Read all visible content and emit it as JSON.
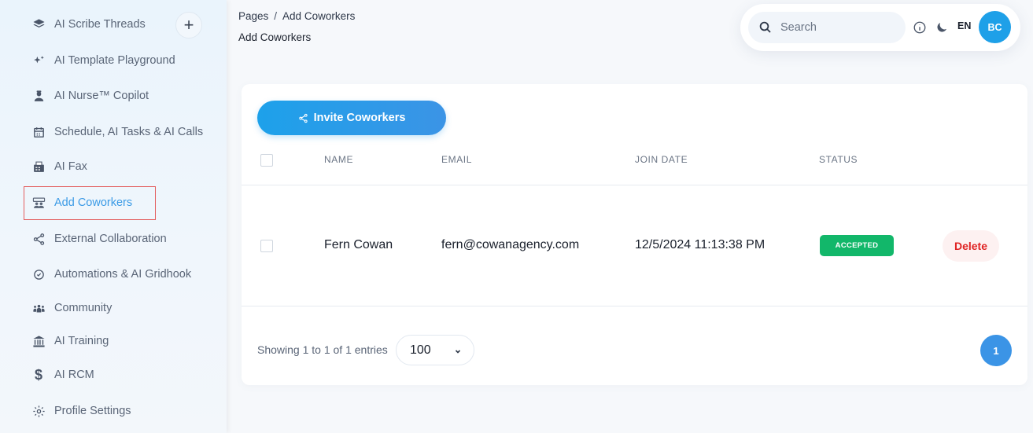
{
  "sidebar": {
    "items": [
      {
        "label": "AI Scribe Threads",
        "icon": "layers-icon"
      },
      {
        "label": "AI Template Playground",
        "icon": "sparkles-icon"
      },
      {
        "label": "AI Nurse™ Copilot",
        "icon": "nurse-icon"
      },
      {
        "label": "Schedule, AI Tasks & AI Calls",
        "icon": "calendar-icon"
      },
      {
        "label": "AI Fax",
        "icon": "fax-icon"
      },
      {
        "label": "Add Coworkers",
        "icon": "coworkers-icon",
        "active": true
      },
      {
        "label": "External Collaboration",
        "icon": "share-icon"
      },
      {
        "label": "Automations & AI Gridhook",
        "icon": "automation-icon"
      },
      {
        "label": "Community",
        "icon": "community-icon"
      },
      {
        "label": "AI Training",
        "icon": "bank-icon"
      },
      {
        "label": "AI RCM",
        "icon": "dollar-icon"
      },
      {
        "label": "Profile Settings",
        "icon": "gear-icon"
      }
    ],
    "add_label": "+"
  },
  "header": {
    "breadcrumb": {
      "root": "Pages",
      "separator": "/",
      "current": "Add Coworkers"
    },
    "title": "Add Coworkers"
  },
  "topbar": {
    "search_placeholder": "Search",
    "language": "EN",
    "avatar_initials": "BC"
  },
  "main": {
    "invite_label": "Invite Coworkers",
    "columns": [
      "NAME",
      "EMAIL",
      "JOIN DATE",
      "STATUS"
    ],
    "rows": [
      {
        "name": "Fern Cowan",
        "email": "fern@cowanagency.com",
        "join_date": "12/5/2024 11:13:38 PM",
        "status": "ACCEPTED",
        "action": "Delete"
      }
    ],
    "showing_text": "Showing 1 to 1 of 1 entries",
    "per_page": "100",
    "current_page": "1"
  },
  "colors": {
    "accent": "#3b94e6",
    "status_accepted": "#12b76a",
    "delete": "#e02424",
    "active_nav": "#3b9be6"
  }
}
